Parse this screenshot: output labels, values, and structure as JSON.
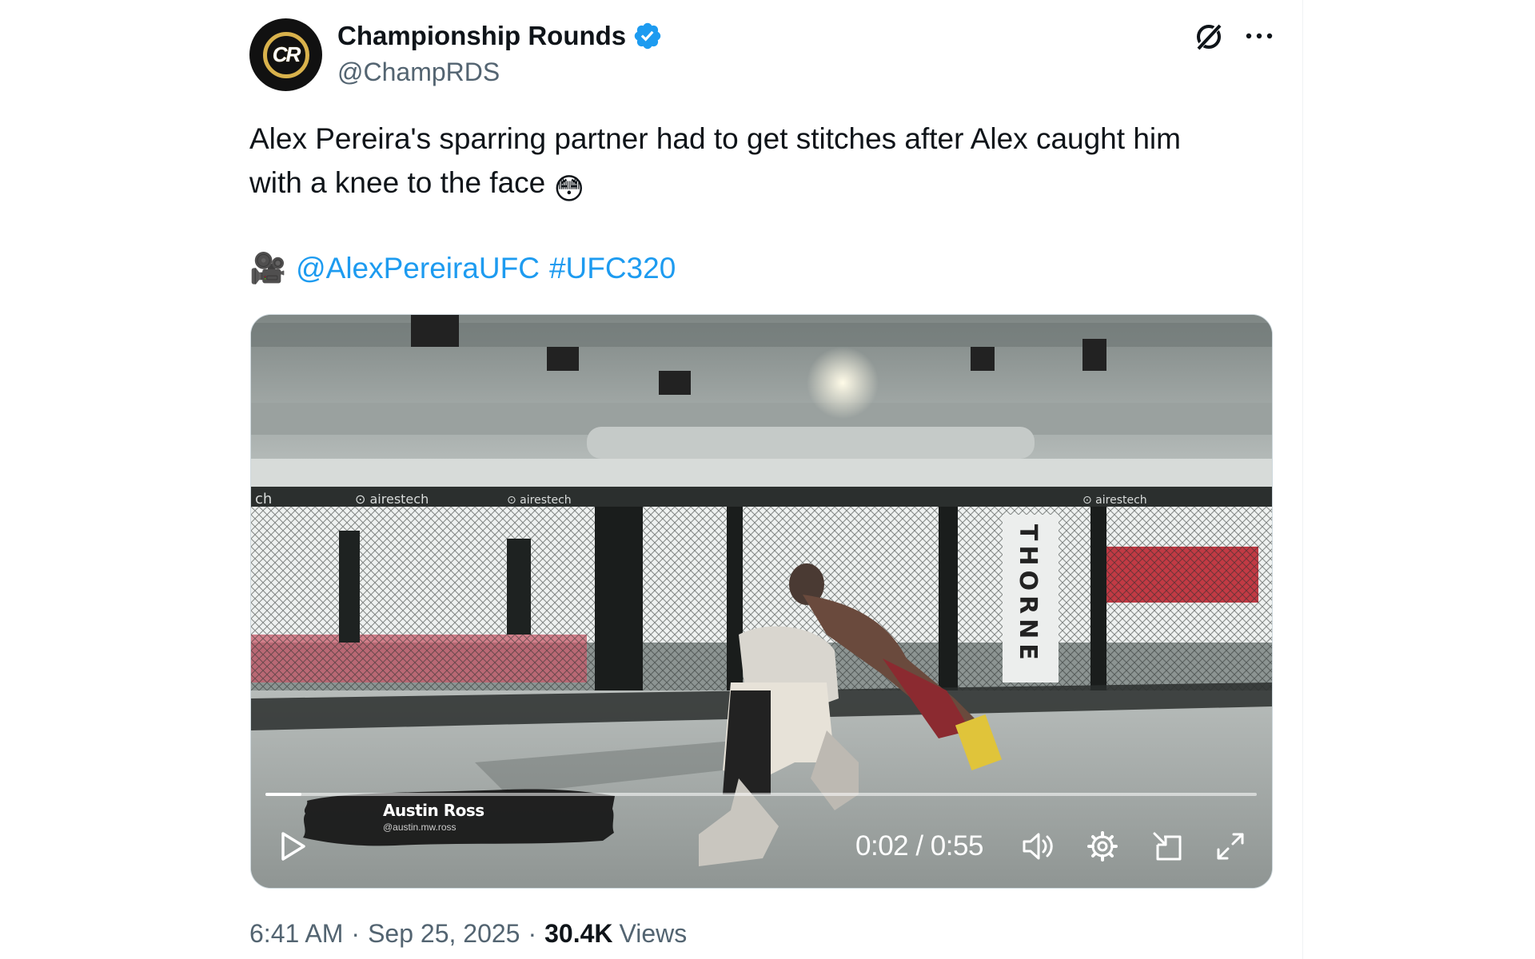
{
  "author": {
    "display_name": "Championship Rounds",
    "handle": "@ChampRDS",
    "avatar_text": "CR",
    "verified": true,
    "verified_color": "#1d9bf0"
  },
  "header_actions": {
    "grok_icon": "grok-icon",
    "more_icon": "more-icon"
  },
  "tweet": {
    "text_line1": "Alex Pereira's sparring partner had to get stitches after Alex caught him",
    "text_line2": "with a knee to the face",
    "emoji": "😳",
    "camera_emoji": "🎥",
    "mention": "@AlexPereiraUFC",
    "hashtag": "#UFC320",
    "link_color": "#1d9bf0"
  },
  "video": {
    "caption_name": "Austin Ross",
    "caption_handle": "@austin.mw.ross",
    "current_time": "0:02",
    "duration": "0:55",
    "timecode": "0:02 / 0:55",
    "progress": 0.036,
    "banner_text": "THORNE",
    "cage_sponsor": "airestech"
  },
  "meta": {
    "time": "6:41 AM",
    "date": "Sep 25, 2025",
    "separator": "·",
    "views_count": "30.4K",
    "views_label": "Views"
  }
}
